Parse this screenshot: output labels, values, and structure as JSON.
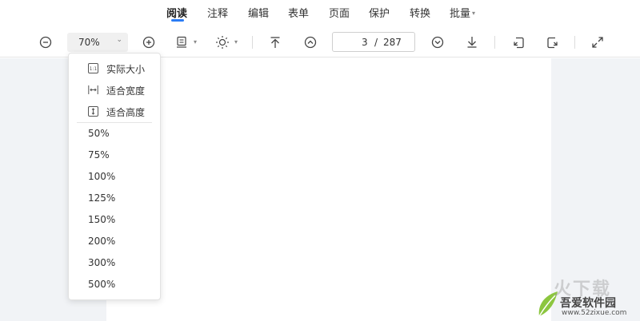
{
  "tabs": [
    {
      "label": "阅读",
      "active": true
    },
    {
      "label": "注释",
      "active": false
    },
    {
      "label": "编辑",
      "active": false
    },
    {
      "label": "表单",
      "active": false
    },
    {
      "label": "页面",
      "active": false
    },
    {
      "label": "保护",
      "active": false
    },
    {
      "label": "转换",
      "active": false
    },
    {
      "label": "批量",
      "active": false,
      "has_caret": true
    }
  ],
  "toolbar": {
    "zoom_value": "70%",
    "page_current": "3",
    "page_separator": "/",
    "page_total": "287",
    "icons": [
      "zoom-out-icon",
      "zoom-in-icon",
      "page-view-icon",
      "brightness-icon",
      "first-page-icon",
      "previous-page-icon",
      "next-page-icon",
      "last-page-icon",
      "rotate-left-icon",
      "rotate-right-icon",
      "fullscreen-icon"
    ]
  },
  "zoom_menu": {
    "fit_options": [
      {
        "label": "实际大小",
        "icon": "actual-size-icon"
      },
      {
        "label": "适合宽度",
        "icon": "fit-width-icon"
      },
      {
        "label": "适合高度",
        "icon": "fit-height-icon"
      }
    ],
    "percent_options": [
      "50%",
      "75%",
      "100%",
      "125%",
      "150%",
      "200%",
      "300%",
      "500%"
    ]
  },
  "watermark": {
    "big_text": "火下载",
    "site_name": "吾爱软件园",
    "url": "www.52zixue.com"
  },
  "colors": {
    "accent": "#2b7cf5",
    "workspace_bg": "#f1f3f6",
    "page_bg": "#ffffff"
  }
}
